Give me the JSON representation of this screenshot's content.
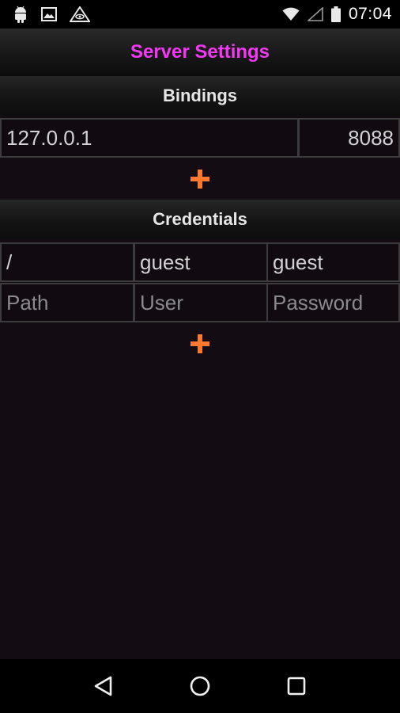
{
  "status_bar": {
    "time": "07:04",
    "icons": [
      "android-icon",
      "image-icon",
      "warning-icon",
      "wifi-icon",
      "signal-icon",
      "battery-icon"
    ]
  },
  "header": {
    "title": "Server Settings"
  },
  "bindings": {
    "title": "Bindings",
    "rows": [
      {
        "address": "127.0.0.1",
        "port": "8088"
      }
    ],
    "add_icon": "plus-icon"
  },
  "credentials": {
    "title": "Credentials",
    "rows": [
      {
        "path": "/",
        "user": "guest",
        "password": "guest"
      }
    ],
    "new_row_placeholders": {
      "path": "Path",
      "user": "User",
      "password": "Password"
    },
    "add_icon": "plus-icon"
  },
  "nav_bar": {
    "icons": [
      "back-icon",
      "home-icon",
      "recents-icon"
    ]
  },
  "colors": {
    "accent_title": "#f238f2",
    "add_button": "#ff7a2e",
    "background": "#130d13",
    "field_border": "#3c3c3c"
  }
}
